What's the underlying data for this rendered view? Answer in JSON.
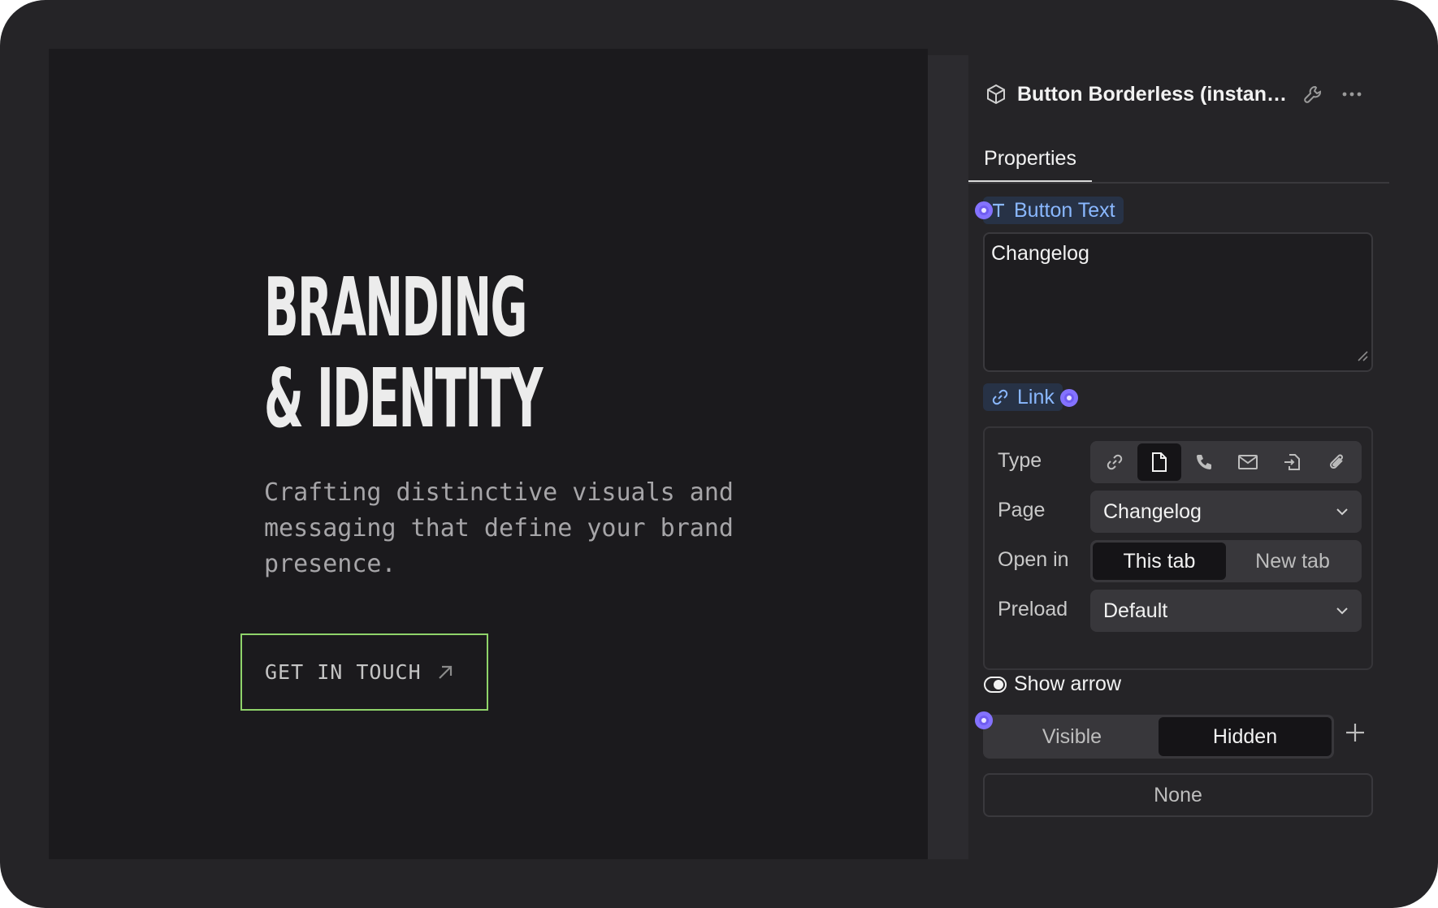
{
  "canvas": {
    "title_line1": "BRANDING",
    "title_line2": "& IDENTITY",
    "subtitle": "Crafting distinctive visuals and messaging that define your brand presence.",
    "cta_label": "GET IN TOUCH",
    "cta_icon": "arrow-up-right-icon",
    "accent_color": "#8fd36a"
  },
  "panel": {
    "header": {
      "icon": "component-cube-icon",
      "title": "Button Borderless (instanc...",
      "wrench_icon": "wrench-icon",
      "more_icon": "more-dots-icon"
    },
    "tabs": [
      {
        "label": "Properties",
        "active": true
      }
    ],
    "button_text": {
      "label": "Button Text",
      "label_icon": "text-T-icon",
      "value": "Changelog"
    },
    "link": {
      "label": "Link",
      "label_icon": "link-icon",
      "type_label": "Type",
      "type_options": [
        "link-icon",
        "page-icon",
        "phone-icon",
        "mail-icon",
        "file-import-icon",
        "attachment-icon"
      ],
      "type_active": "page-icon",
      "page_label": "Page",
      "page_value": "Changelog",
      "open_in_label": "Open in",
      "open_in_options": [
        "This tab",
        "New tab"
      ],
      "open_in_active": "This tab",
      "preload_label": "Preload",
      "preload_value": "Default"
    },
    "show_arrow": {
      "label": "Show arrow",
      "options": [
        "Visible",
        "Hidden"
      ],
      "active": "Hidden"
    },
    "none_button": "None",
    "colors": {
      "label_bg": "#273246",
      "label_text": "#8ab8ff",
      "variable_dot": "#6f5cf0"
    }
  }
}
